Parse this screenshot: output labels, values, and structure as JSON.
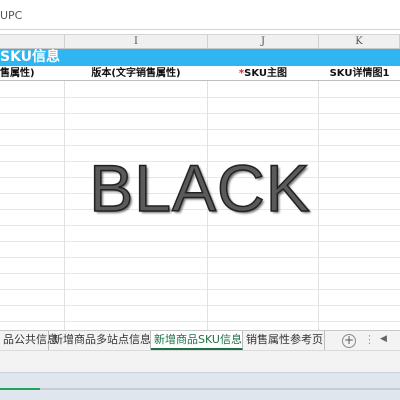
{
  "formula_bar": {
    "cell_text": "UPC"
  },
  "column_headers": [
    "I",
    "J",
    "K"
  ],
  "section": {
    "title": "SKU信息"
  },
  "attribute_row": {
    "first_label": "售属性)",
    "version_label": "版本(文字销售属性)",
    "main_image_required_mark": "*",
    "main_image_label": "SKU主图",
    "detail_image_label": "SKU详情图1"
  },
  "watermark": {
    "text": "BLACK"
  },
  "sheet_tabs": [
    {
      "label": "品公共信息",
      "active": false
    },
    {
      "label": "新增商品多站点信息",
      "active": false
    },
    {
      "label": "新增商品SKU信息",
      "active": true
    },
    {
      "label": "销售属性参考页",
      "active": false
    }
  ],
  "sheet_bar": {
    "add_sheet_icon": "plus-circle-icon",
    "add_label": "+",
    "more_label": "⋮",
    "scroll_icon": "triangle-left-icon",
    "scroll_label": "◀"
  },
  "colors": {
    "section_banner": "#2fb5ef",
    "active_tab": "#1e7145",
    "required_mark": "#e02424",
    "progress": "#24a35a"
  },
  "progress": {
    "fraction": 0.1
  }
}
